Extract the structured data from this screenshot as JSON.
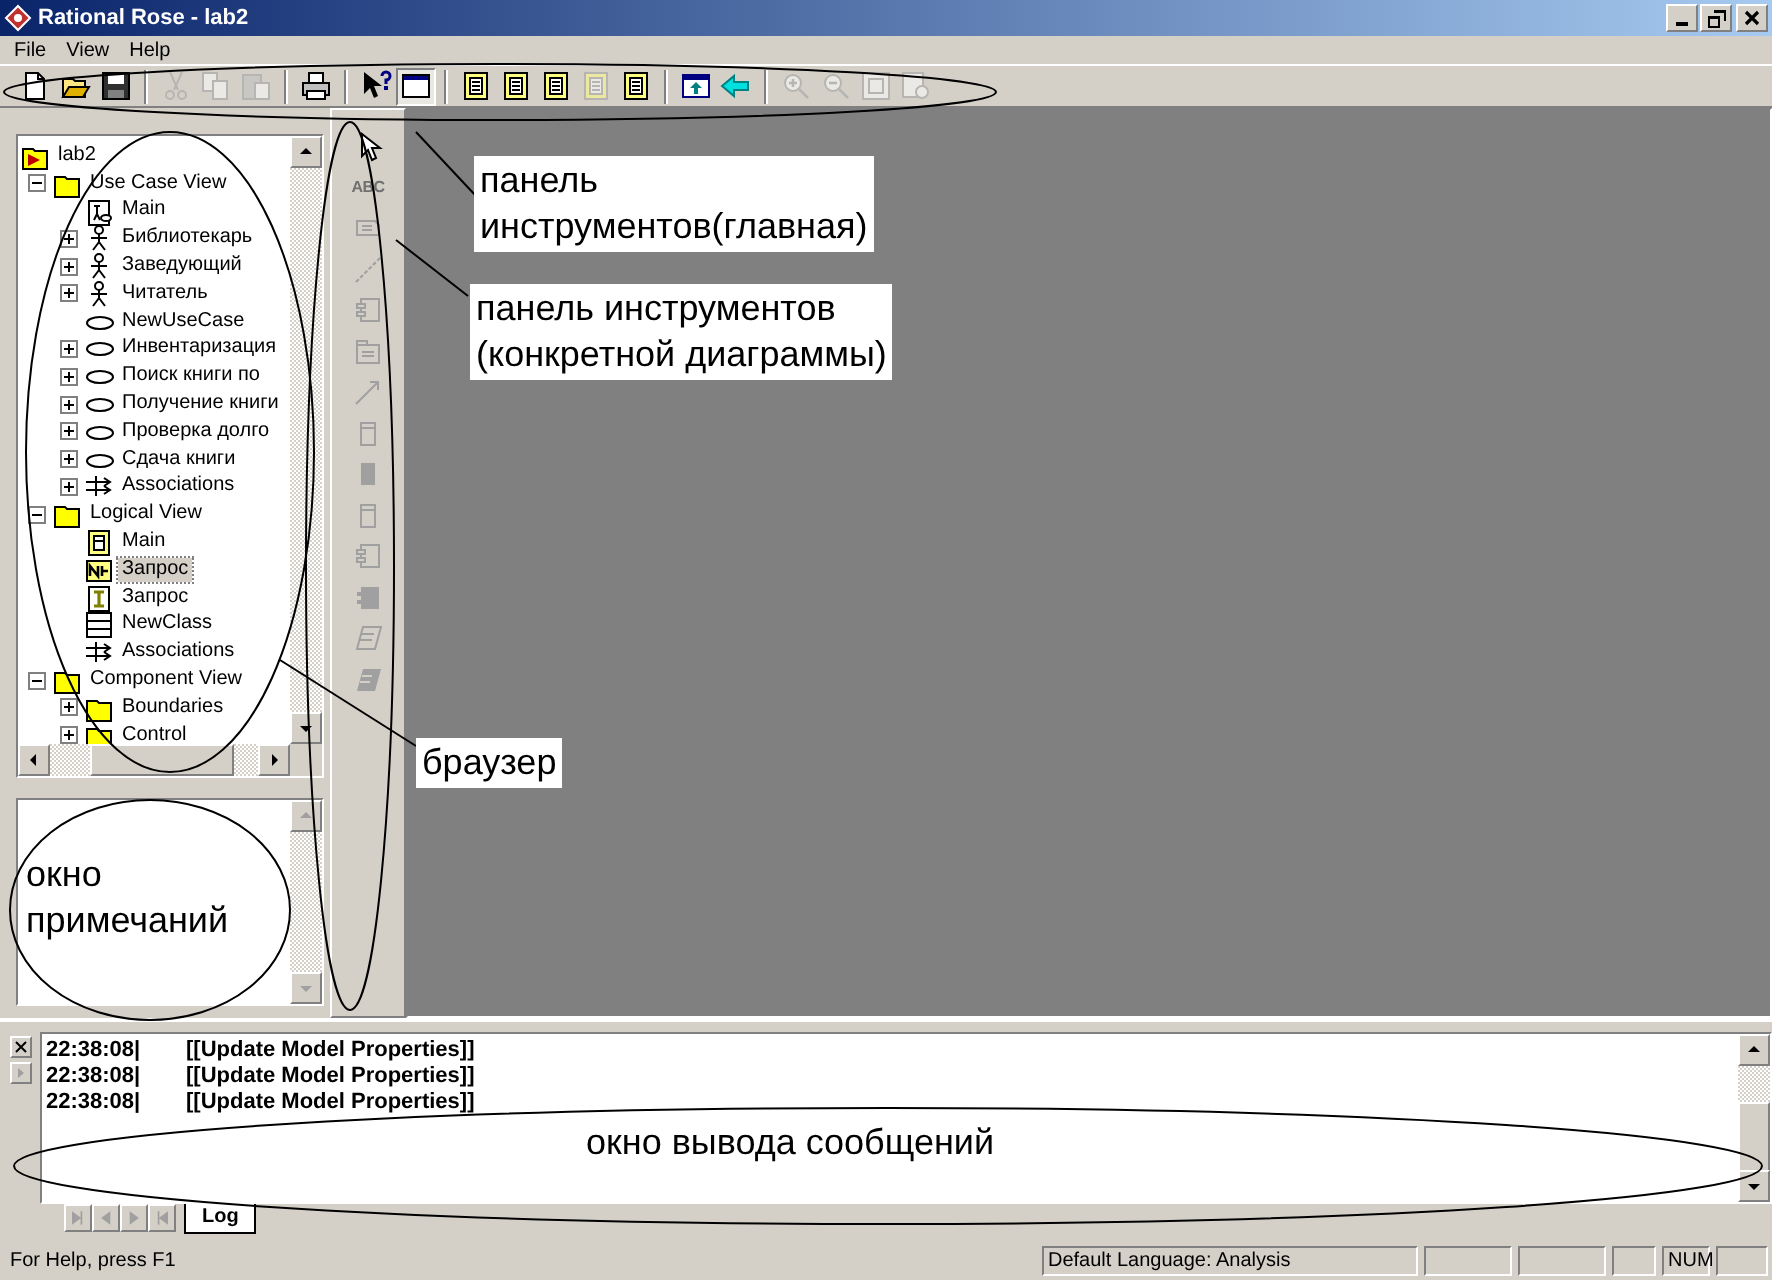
{
  "window": {
    "title": "Rational Rose - lab2"
  },
  "menu": [
    {
      "label": "File"
    },
    {
      "label": "View"
    },
    {
      "label": "Help"
    }
  ],
  "toolbar": [
    [
      {
        "kind": "new",
        "disabled": false,
        "pressed": false
      },
      {
        "kind": "open",
        "disabled": false,
        "pressed": false
      },
      {
        "kind": "save",
        "disabled": false,
        "pressed": false
      }
    ],
    [
      {
        "kind": "cut",
        "disabled": true,
        "pressed": false
      },
      {
        "kind": "copy",
        "disabled": true,
        "pressed": false
      },
      {
        "kind": "paste",
        "disabled": true,
        "pressed": false
      }
    ],
    [
      {
        "kind": "print",
        "disabled": false,
        "pressed": false
      }
    ],
    [
      {
        "kind": "help",
        "disabled": false,
        "pressed": false
      },
      {
        "kind": "window",
        "disabled": false,
        "pressed": true
      }
    ],
    [
      {
        "kind": "diagram",
        "disabled": false,
        "pressed": false
      },
      {
        "kind": "diagram",
        "disabled": false,
        "pressed": false
      },
      {
        "kind": "diagram",
        "disabled": false,
        "pressed": false
      },
      {
        "kind": "diagram",
        "disabled": true,
        "pressed": false
      },
      {
        "kind": "diagram",
        "disabled": false,
        "pressed": false
      }
    ],
    [
      {
        "kind": "up",
        "disabled": false,
        "pressed": false
      },
      {
        "kind": "back",
        "disabled": false,
        "pressed": false
      }
    ],
    [
      {
        "kind": "zoomin",
        "disabled": true,
        "pressed": false
      },
      {
        "kind": "zoomout",
        "disabled": true,
        "pressed": false
      },
      {
        "kind": "fit",
        "disabled": true,
        "pressed": false
      },
      {
        "kind": "page",
        "disabled": true,
        "pressed": false
      }
    ]
  ],
  "browser": {
    "tree": [
      {
        "label": "lab2",
        "kind": "model",
        "selected": false,
        "children": [
          {
            "label": "Use Case View",
            "kind": "folder",
            "expanded": true,
            "selected": false,
            "children": [
              {
                "label": "Main",
                "kind": "usecasediagram",
                "selected": false
              },
              {
                "label": "Библиотекарь",
                "kind": "actor",
                "expanded": false,
                "selected": false
              },
              {
                "label": "Заведующий",
                "kind": "actor",
                "expanded": false,
                "selected": false
              },
              {
                "label": "Читатель",
                "kind": "actor",
                "expanded": false,
                "selected": false
              },
              {
                "label": "NewUseCase",
                "kind": "usecase",
                "selected": false
              },
              {
                "label": "Инвентаризация",
                "kind": "usecase",
                "expanded": false,
                "selected": false
              },
              {
                "label": "Поиск книги по",
                "kind": "usecase",
                "expanded": false,
                "selected": false
              },
              {
                "label": "Получение книги",
                "kind": "usecase",
                "expanded": false,
                "selected": false
              },
              {
                "label": "Проверка долго",
                "kind": "usecase",
                "expanded": false,
                "selected": false
              },
              {
                "label": "Сдача книги",
                "kind": "usecase",
                "expanded": false,
                "selected": false
              },
              {
                "label": "Associations",
                "kind": "associations",
                "expanded": false,
                "selected": false
              }
            ]
          },
          {
            "label": "Logical View",
            "kind": "folder",
            "expanded": true,
            "selected": false,
            "children": [
              {
                "label": "Main",
                "kind": "classdiagram",
                "selected": false
              },
              {
                "label": "Запрос",
                "kind": "stereotype",
                "selected": true
              },
              {
                "label": "Запрос",
                "kind": "interface",
                "selected": false
              },
              {
                "label": "NewClass",
                "kind": "class",
                "selected": false
              },
              {
                "label": "Associations",
                "kind": "associations",
                "selected": false
              }
            ]
          },
          {
            "label": "Component View",
            "kind": "folder",
            "expanded": true,
            "selected": false,
            "children": [
              {
                "label": "Boundaries",
                "kind": "folder",
                "expanded": false,
                "selected": false
              },
              {
                "label": "Control",
                "kind": "folder",
                "expanded": false,
                "selected": false
              }
            ]
          }
        ]
      }
    ]
  },
  "toolbox": [
    {
      "kind": "pointer",
      "disabled": false
    },
    {
      "kind": "text",
      "label": "ABC",
      "disabled": true
    },
    {
      "kind": "note",
      "disabled": true
    },
    {
      "kind": "line",
      "disabled": true
    },
    {
      "kind": "component",
      "disabled": true
    },
    {
      "kind": "package",
      "disabled": true
    },
    {
      "kind": "arrow",
      "disabled": true
    },
    {
      "kind": "box",
      "disabled": true
    },
    {
      "kind": "solidbox",
      "disabled": true
    },
    {
      "kind": "box",
      "disabled": true
    },
    {
      "kind": "component",
      "disabled": true
    },
    {
      "kind": "solidcomponent",
      "disabled": true
    },
    {
      "kind": "slanted",
      "disabled": true
    },
    {
      "kind": "solidslanted",
      "disabled": true
    }
  ],
  "log": {
    "lines": [
      {
        "time": "22:38:08|",
        "message": "[[Update Model Properties]]"
      },
      {
        "time": "22:38:08|",
        "message": "[[Update Model Properties]]"
      },
      {
        "time": "22:38:08|",
        "message": "[[Update Model Properties]]"
      }
    ],
    "tabs": [
      {
        "label": "Log",
        "selected": true
      }
    ]
  },
  "status_bar": {
    "help": "For Help, press F1",
    "language": "Default Language: Analysis",
    "indicator": "NUM"
  },
  "annotations": [
    {
      "kind": "box",
      "text": "панель\nинструментов(главная)"
    },
    {
      "kind": "box",
      "text": "панель инструментов\n(конкретной диаграммы)"
    },
    {
      "kind": "box",
      "text": "браузер"
    },
    {
      "kind": "plain",
      "text": "окно\nпримечаний"
    },
    {
      "kind": "plain",
      "text": "окно вывода сообщений"
    }
  ]
}
